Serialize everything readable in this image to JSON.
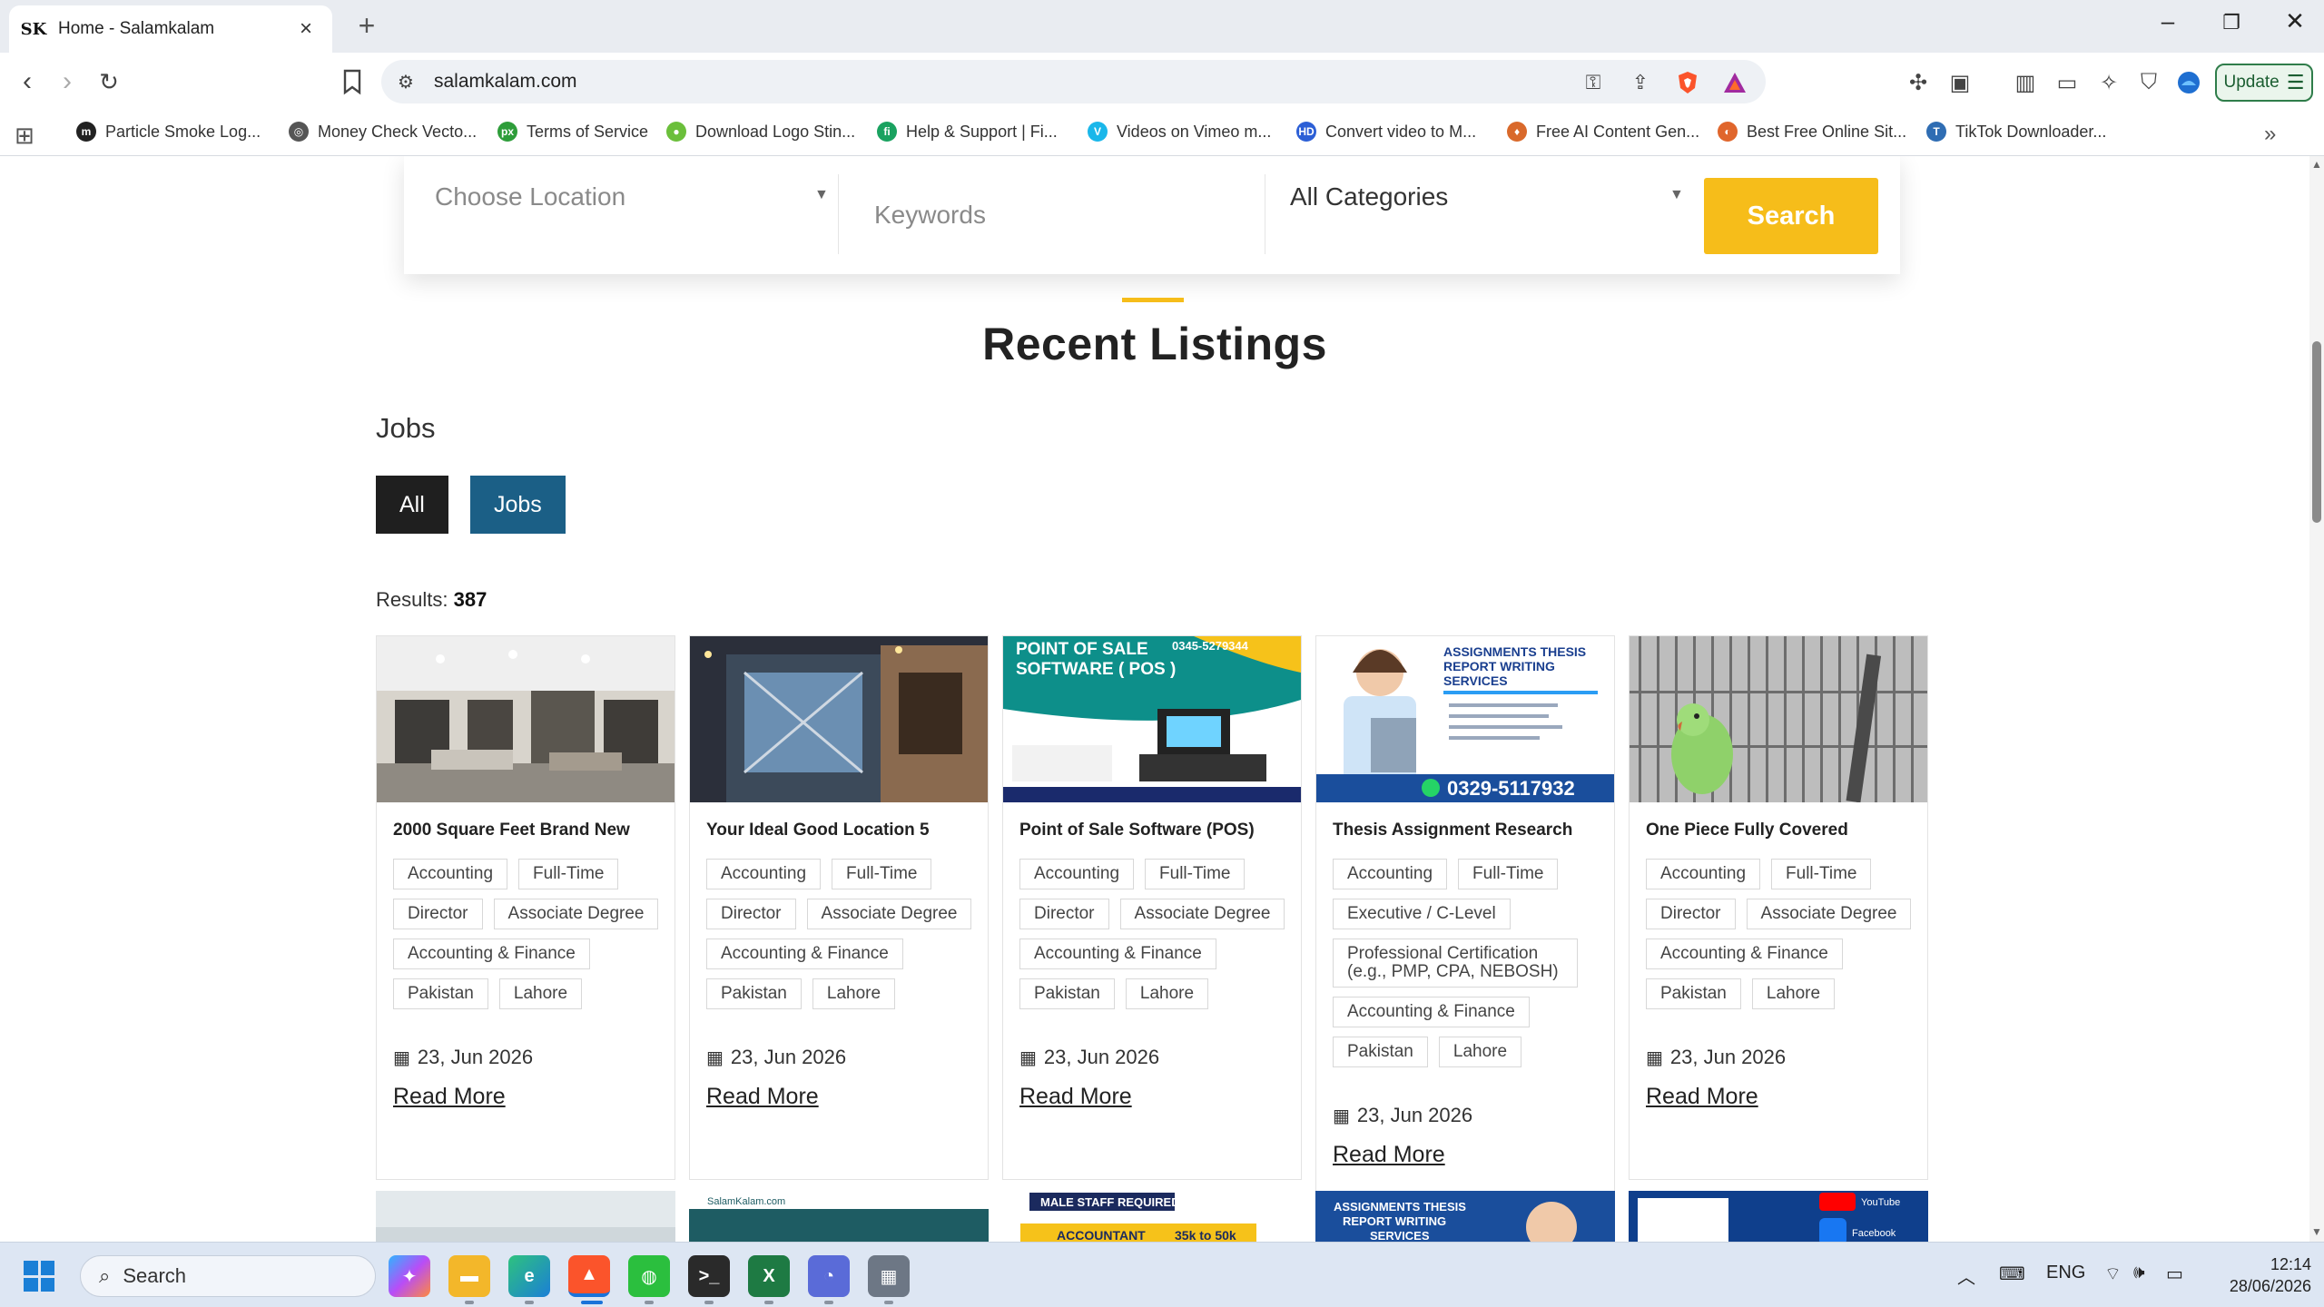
{
  "browser": {
    "tab_title": "Home - Salamkalam",
    "tab_favicon": "SK",
    "url": "salamkalam.com",
    "update_label": "Update",
    "accent": "#f6bd1a"
  },
  "bookmarks": [
    {
      "label": "Particle Smoke Log...",
      "icon": "m",
      "color": "#222222"
    },
    {
      "label": "Money Check Vecto...",
      "icon": "◎",
      "color": "#555555"
    },
    {
      "label": "Terms of Service",
      "icon": "px",
      "color": "#2e9d3a"
    },
    {
      "label": "Download Logo Stin...",
      "icon": "●",
      "color": "#6bbf3b"
    },
    {
      "label": "Help & Support | Fi...",
      "icon": "fi",
      "color": "#1aa260"
    },
    {
      "label": "Videos on Vimeo m...",
      "icon": "V",
      "color": "#1ab7ea"
    },
    {
      "label": "Convert video to M...",
      "icon": "HD",
      "color": "#2c5fd6"
    },
    {
      "label": "Free AI Content Gen...",
      "icon": "♦",
      "color": "#d9692b"
    },
    {
      "label": "Best Free Online Sit...",
      "icon": "◐",
      "color": "#e0662c"
    },
    {
      "label": "TikTok Downloader...",
      "icon": "T",
      "color": "#2f6db3"
    }
  ],
  "search": {
    "location_placeholder": "Choose Location",
    "keywords_placeholder": "Keywords",
    "category_value": "All Categories",
    "button_label": "Search"
  },
  "section": {
    "title": "Recent Listings",
    "category_heading": "Jobs",
    "filters": [
      {
        "label": "All",
        "color": "#1f1f1f"
      },
      {
        "label": "Jobs",
        "color": "#1b5f86"
      }
    ],
    "results_label": "Results:",
    "results_count": "387"
  },
  "listings": [
    {
      "title": "2000 Square Feet Brand New",
      "image": "office-interior",
      "tags": [
        "Accounting",
        "Full-Time",
        "Director",
        "Associate Degree",
        "Accounting & Finance",
        "Pakistan",
        "Lahore"
      ],
      "date": "23, Jun 2026",
      "read_more": "Read More"
    },
    {
      "title": "Your Ideal Good Location 5",
      "image": "house-facade",
      "tags": [
        "Accounting",
        "Full-Time",
        "Director",
        "Associate Degree",
        "Accounting & Finance",
        "Pakistan",
        "Lahore"
      ],
      "date": "23, Jun 2026",
      "read_more": "Read More"
    },
    {
      "title": "Point of Sale Software (POS)",
      "image": "pos-flyer",
      "image_text": [
        "POINT OF SALE",
        "SOFTWARE ( POS )",
        "0345-5279344"
      ],
      "tags": [
        "Accounting",
        "Full-Time",
        "Director",
        "Associate Degree",
        "Accounting & Finance",
        "Pakistan",
        "Lahore"
      ],
      "date": "23, Jun 2026",
      "read_more": "Read More"
    },
    {
      "title": "Thesis Assignment Research",
      "image": "thesis-flyer",
      "image_text": [
        "ASSIGNMENTS THESIS",
        "REPORT WRITING",
        "SERVICES",
        "0329-5117932"
      ],
      "tags": [
        "Accounting",
        "Full-Time",
        "Executive / C-Level",
        "Professional Certification (e.g., PMP, CPA, NEBOSH)",
        "Accounting & Finance",
        "Pakistan",
        "Lahore"
      ],
      "date": "23, Jun 2026",
      "read_more": "Read More"
    },
    {
      "title": "One Piece Fully Covered",
      "image": "parrot-cage",
      "tags": [
        "Accounting",
        "Full-Time",
        "Director",
        "Associate Degree",
        "Accounting & Finance",
        "Pakistan",
        "Lahore"
      ],
      "date": "23, Jun 2026",
      "read_more": "Read More"
    }
  ],
  "next_row_text": [
    "SalamKalam.com",
    "MALE STAFF REQUIRED",
    "ACCOUNTANT",
    "35k to 50k",
    "ASSIGNMENTS THESIS",
    "REPORT WRITING",
    "SERVICES",
    "YouTube",
    "Facebook"
  ],
  "taskbar": {
    "search_label": "Search",
    "language": "ENG",
    "time": "12:14",
    "date": "28/06/2026"
  }
}
